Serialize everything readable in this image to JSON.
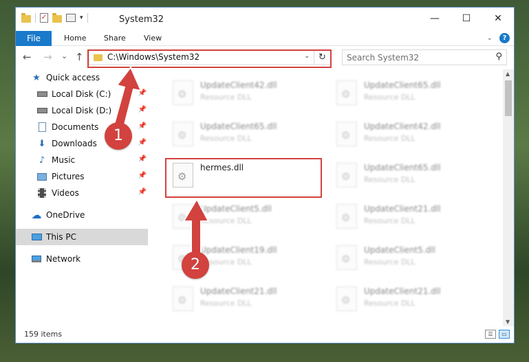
{
  "window": {
    "title": "System32",
    "controls": {
      "minimize": "—",
      "maximize": "☐",
      "close": "✕"
    }
  },
  "ribbon": {
    "tabs": [
      "File",
      "Home",
      "Share",
      "View"
    ],
    "help": "?"
  },
  "navigation": {
    "back": "←",
    "forward": "→",
    "recent": "⌄",
    "up": "↑",
    "address": "C:\\Windows\\System32",
    "refresh": "↻",
    "search_placeholder": "Search System32"
  },
  "sidebar": {
    "items": [
      {
        "label": "Quick access",
        "icon": "star-icon"
      },
      {
        "label": "Local Disk (C:)",
        "icon": "drive-icon",
        "pinned": true
      },
      {
        "label": "Local Disk (D:)",
        "icon": "drive-icon",
        "pinned": true
      },
      {
        "label": "Documents",
        "icon": "documents-icon",
        "pinned": true
      },
      {
        "label": "Downloads",
        "icon": "download-icon",
        "pinned": true
      },
      {
        "label": "Music",
        "icon": "music-icon",
        "pinned": true
      },
      {
        "label": "Pictures",
        "icon": "pictures-icon",
        "pinned": true
      },
      {
        "label": "Videos",
        "icon": "videos-icon",
        "pinned": true
      },
      {
        "label": "OneDrive",
        "icon": "cloud-icon"
      },
      {
        "label": "This PC",
        "icon": "computer-icon",
        "selected": true
      },
      {
        "label": "Network",
        "icon": "network-icon"
      }
    ]
  },
  "files": [
    {
      "name": "UpdateClient42.dll",
      "type": "Resource DLL"
    },
    {
      "name": "UpdateClient65.dll",
      "type": "Resource DLL"
    },
    {
      "name": "UpdateClient65.dll",
      "type": "Resource DLL"
    },
    {
      "name": "UpdateClient42.dll",
      "type": "Resource DLL"
    },
    {
      "name": "hermes.dll",
      "type": ""
    },
    {
      "name": "UpdateClient65.dll",
      "type": "Resource DLL"
    },
    {
      "name": "UpdateClient5.dll",
      "type": "Resource DLL"
    },
    {
      "name": "UpdateClient21.dll",
      "type": "Resource DLL"
    },
    {
      "name": "UpdateClient19.dll",
      "type": "Resource DLL"
    },
    {
      "name": "UpdateClient5.dll",
      "type": "Resource DLL"
    },
    {
      "name": "UpdateClient21.dll",
      "type": "Resource DLL"
    },
    {
      "name": "UpdateClient21.dll",
      "type": "Resource DLL"
    }
  ],
  "status": {
    "item_count": "159 items"
  },
  "annotations": {
    "step1": "1",
    "step2": "2",
    "color": "#d2423e"
  }
}
